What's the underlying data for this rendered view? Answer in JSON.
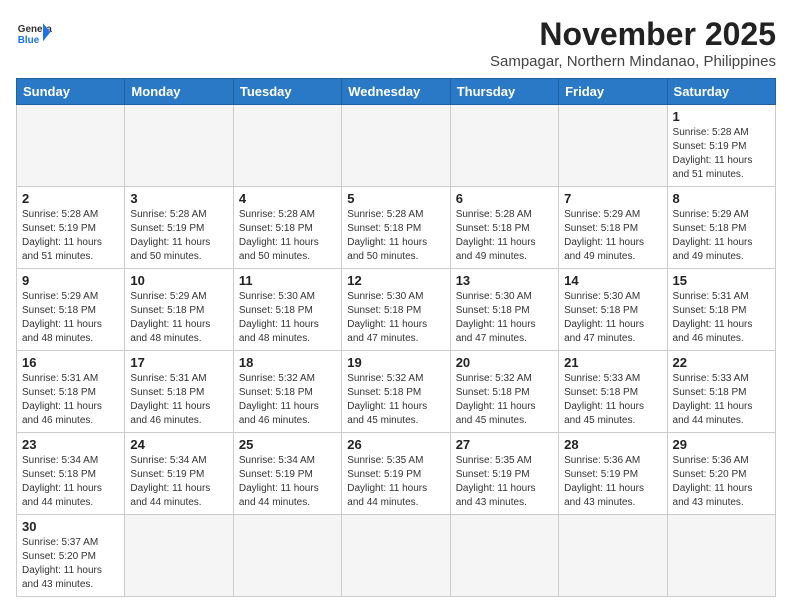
{
  "header": {
    "logo_general": "General",
    "logo_blue": "Blue",
    "month_title": "November 2025",
    "location": "Sampagar, Northern Mindanao, Philippines"
  },
  "weekdays": [
    "Sunday",
    "Monday",
    "Tuesday",
    "Wednesday",
    "Thursday",
    "Friday",
    "Saturday"
  ],
  "weeks": [
    [
      {
        "day": "",
        "info": ""
      },
      {
        "day": "",
        "info": ""
      },
      {
        "day": "",
        "info": ""
      },
      {
        "day": "",
        "info": ""
      },
      {
        "day": "",
        "info": ""
      },
      {
        "day": "",
        "info": ""
      },
      {
        "day": "1",
        "info": "Sunrise: 5:28 AM\nSunset: 5:19 PM\nDaylight: 11 hours\nand 51 minutes."
      }
    ],
    [
      {
        "day": "2",
        "info": "Sunrise: 5:28 AM\nSunset: 5:19 PM\nDaylight: 11 hours\nand 51 minutes."
      },
      {
        "day": "3",
        "info": "Sunrise: 5:28 AM\nSunset: 5:19 PM\nDaylight: 11 hours\nand 50 minutes."
      },
      {
        "day": "4",
        "info": "Sunrise: 5:28 AM\nSunset: 5:18 PM\nDaylight: 11 hours\nand 50 minutes."
      },
      {
        "day": "5",
        "info": "Sunrise: 5:28 AM\nSunset: 5:18 PM\nDaylight: 11 hours\nand 50 minutes."
      },
      {
        "day": "6",
        "info": "Sunrise: 5:28 AM\nSunset: 5:18 PM\nDaylight: 11 hours\nand 49 minutes."
      },
      {
        "day": "7",
        "info": "Sunrise: 5:29 AM\nSunset: 5:18 PM\nDaylight: 11 hours\nand 49 minutes."
      },
      {
        "day": "8",
        "info": "Sunrise: 5:29 AM\nSunset: 5:18 PM\nDaylight: 11 hours\nand 49 minutes."
      }
    ],
    [
      {
        "day": "9",
        "info": "Sunrise: 5:29 AM\nSunset: 5:18 PM\nDaylight: 11 hours\nand 48 minutes."
      },
      {
        "day": "10",
        "info": "Sunrise: 5:29 AM\nSunset: 5:18 PM\nDaylight: 11 hours\nand 48 minutes."
      },
      {
        "day": "11",
        "info": "Sunrise: 5:30 AM\nSunset: 5:18 PM\nDaylight: 11 hours\nand 48 minutes."
      },
      {
        "day": "12",
        "info": "Sunrise: 5:30 AM\nSunset: 5:18 PM\nDaylight: 11 hours\nand 47 minutes."
      },
      {
        "day": "13",
        "info": "Sunrise: 5:30 AM\nSunset: 5:18 PM\nDaylight: 11 hours\nand 47 minutes."
      },
      {
        "day": "14",
        "info": "Sunrise: 5:30 AM\nSunset: 5:18 PM\nDaylight: 11 hours\nand 47 minutes."
      },
      {
        "day": "15",
        "info": "Sunrise: 5:31 AM\nSunset: 5:18 PM\nDaylight: 11 hours\nand 46 minutes."
      }
    ],
    [
      {
        "day": "16",
        "info": "Sunrise: 5:31 AM\nSunset: 5:18 PM\nDaylight: 11 hours\nand 46 minutes."
      },
      {
        "day": "17",
        "info": "Sunrise: 5:31 AM\nSunset: 5:18 PM\nDaylight: 11 hours\nand 46 minutes."
      },
      {
        "day": "18",
        "info": "Sunrise: 5:32 AM\nSunset: 5:18 PM\nDaylight: 11 hours\nand 46 minutes."
      },
      {
        "day": "19",
        "info": "Sunrise: 5:32 AM\nSunset: 5:18 PM\nDaylight: 11 hours\nand 45 minutes."
      },
      {
        "day": "20",
        "info": "Sunrise: 5:32 AM\nSunset: 5:18 PM\nDaylight: 11 hours\nand 45 minutes."
      },
      {
        "day": "21",
        "info": "Sunrise: 5:33 AM\nSunset: 5:18 PM\nDaylight: 11 hours\nand 45 minutes."
      },
      {
        "day": "22",
        "info": "Sunrise: 5:33 AM\nSunset: 5:18 PM\nDaylight: 11 hours\nand 44 minutes."
      }
    ],
    [
      {
        "day": "23",
        "info": "Sunrise: 5:34 AM\nSunset: 5:18 PM\nDaylight: 11 hours\nand 44 minutes."
      },
      {
        "day": "24",
        "info": "Sunrise: 5:34 AM\nSunset: 5:19 PM\nDaylight: 11 hours\nand 44 minutes."
      },
      {
        "day": "25",
        "info": "Sunrise: 5:34 AM\nSunset: 5:19 PM\nDaylight: 11 hours\nand 44 minutes."
      },
      {
        "day": "26",
        "info": "Sunrise: 5:35 AM\nSunset: 5:19 PM\nDaylight: 11 hours\nand 44 minutes."
      },
      {
        "day": "27",
        "info": "Sunrise: 5:35 AM\nSunset: 5:19 PM\nDaylight: 11 hours\nand 43 minutes."
      },
      {
        "day": "28",
        "info": "Sunrise: 5:36 AM\nSunset: 5:19 PM\nDaylight: 11 hours\nand 43 minutes."
      },
      {
        "day": "29",
        "info": "Sunrise: 5:36 AM\nSunset: 5:20 PM\nDaylight: 11 hours\nand 43 minutes."
      }
    ],
    [
      {
        "day": "30",
        "info": "Sunrise: 5:37 AM\nSunset: 5:20 PM\nDaylight: 11 hours\nand 43 minutes."
      },
      {
        "day": "",
        "info": ""
      },
      {
        "day": "",
        "info": ""
      },
      {
        "day": "",
        "info": ""
      },
      {
        "day": "",
        "info": ""
      },
      {
        "day": "",
        "info": ""
      },
      {
        "day": "",
        "info": ""
      }
    ]
  ]
}
